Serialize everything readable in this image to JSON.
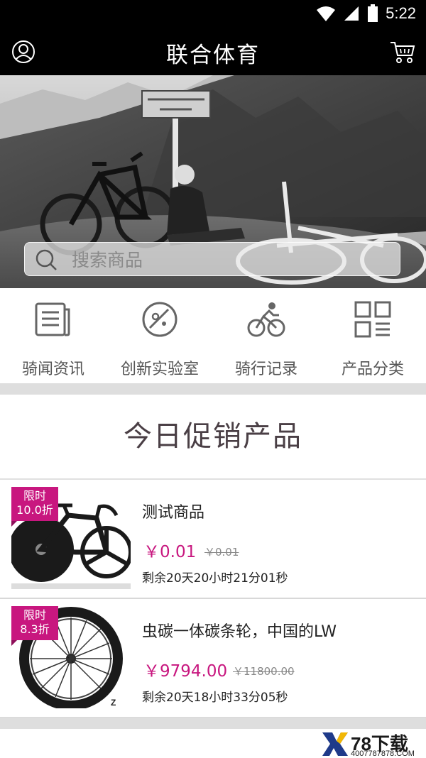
{
  "status_bar": {
    "time": "5:22"
  },
  "header": {
    "title": "联合体育"
  },
  "search": {
    "placeholder": "搜索商品"
  },
  "categories": [
    {
      "label": "骑闻资讯",
      "icon": "news-icon"
    },
    {
      "label": "创新实验室",
      "icon": "lab-icon"
    },
    {
      "label": "骑行记录",
      "icon": "cyclist-icon"
    },
    {
      "label": "产品分类",
      "icon": "grid-icon"
    }
  ],
  "section": {
    "title": "今日促销产品"
  },
  "products": [
    {
      "badge_line1": "限时",
      "badge_line2": "10.0折",
      "name": "测试商品",
      "price": "￥0.01",
      "old_price": "￥0.01",
      "countdown": "剩余20天20小时21分01秒"
    },
    {
      "badge_line1": "限时",
      "badge_line2": "8.3折",
      "name": "虫碳一体碳条轮，中国的LW",
      "price": "￥9794.00",
      "old_price": "￥11800.00",
      "countdown": "剩余20天18小时33分05秒"
    }
  ],
  "watermark": {
    "main": "78下载",
    "sub": "4007787878.COM"
  },
  "colors": {
    "accent": "#c8177f",
    "header_bg": "#000000",
    "divider": "#dedede"
  }
}
